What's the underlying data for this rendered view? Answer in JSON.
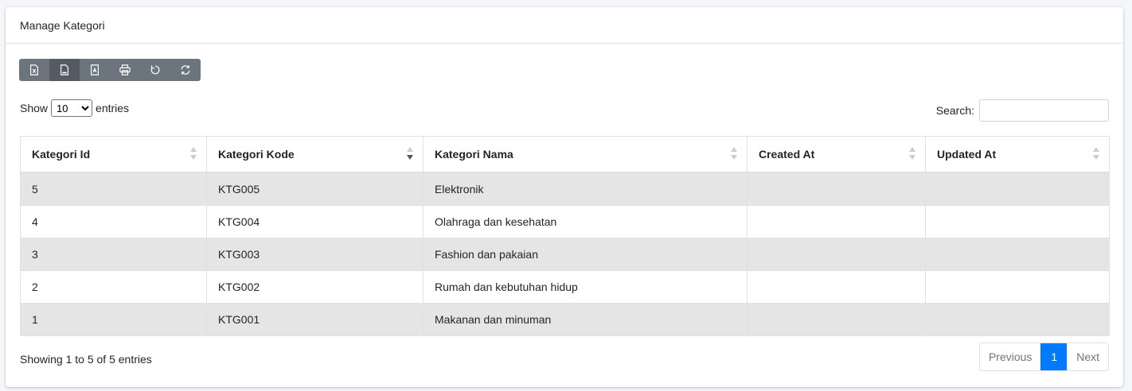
{
  "card": {
    "title": "Manage Kategori"
  },
  "toolbar": {
    "buttons": [
      {
        "icon": "excel-icon"
      },
      {
        "icon": "csv-icon"
      },
      {
        "icon": "pdf-icon"
      },
      {
        "icon": "print-icon"
      },
      {
        "icon": "reset-icon"
      },
      {
        "icon": "reload-icon"
      }
    ]
  },
  "length": {
    "prefix": "Show",
    "value": "10",
    "suffix": "entries"
  },
  "search": {
    "label": "Search:",
    "value": ""
  },
  "table": {
    "headers": [
      "Kategori Id",
      "Kategori Kode",
      "Kategori Nama",
      "Created At",
      "Updated At"
    ],
    "rows": [
      [
        "5",
        "KTG005",
        "Elektronik",
        "",
        ""
      ],
      [
        "4",
        "KTG004",
        "Olahraga dan kesehatan",
        "",
        ""
      ],
      [
        "3",
        "KTG003",
        "Fashion dan pakaian",
        "",
        ""
      ],
      [
        "2",
        "KTG002",
        "Rumah dan kebutuhan hidup",
        "",
        ""
      ],
      [
        "1",
        "KTG001",
        "Makanan dan minuman",
        "",
        ""
      ]
    ]
  },
  "footer": {
    "info": "Showing 1 to 5 of 5 entries"
  },
  "pagination": {
    "previous": "Previous",
    "current": "1",
    "next": "Next"
  },
  "colors": {
    "accent": "#007bff",
    "toolbar": "#6c757d",
    "stripe": "#e5e5e5"
  }
}
